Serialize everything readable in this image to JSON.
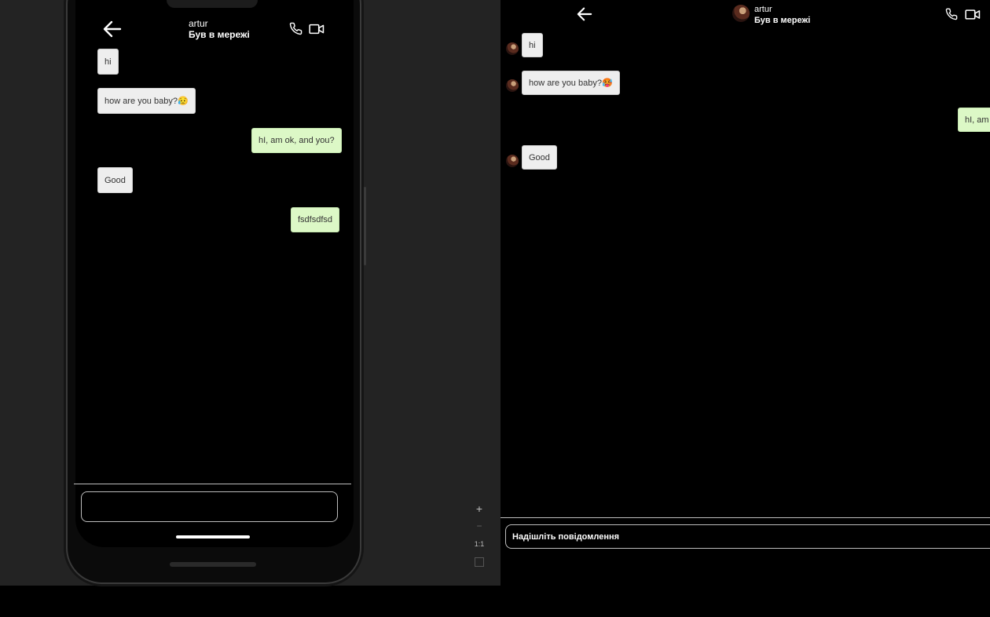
{
  "chat": {
    "contact_name": "artur",
    "contact_status": "Був в мережі"
  },
  "messages": [
    {
      "text": "hi",
      "dir": "in"
    },
    {
      "text": "how are you baby?😥",
      "dir": "in"
    },
    {
      "text": "hI, am ok, and you?",
      "dir": "out"
    },
    {
      "text": "Good",
      "dir": "in"
    },
    {
      "text": "fsdfsdfsd",
      "dir": "out"
    }
  ],
  "web_messages": [
    {
      "text": "hi",
      "dir": "in"
    },
    {
      "text": "how are you baby?🥵",
      "dir": "in"
    },
    {
      "text": "hI, am",
      "dir": "out"
    },
    {
      "text": "Good",
      "dir": "in"
    }
  ],
  "composer": {
    "mobile_placeholder": "",
    "web_placeholder": "Надішліть повідомлення"
  },
  "zoom_controls": {
    "zoom_in": "+",
    "zoom_out": "−",
    "actual_size": "1:1"
  },
  "icons": {
    "back": "arrow-left-icon",
    "call": "phone-icon",
    "video": "video-camera-icon"
  }
}
